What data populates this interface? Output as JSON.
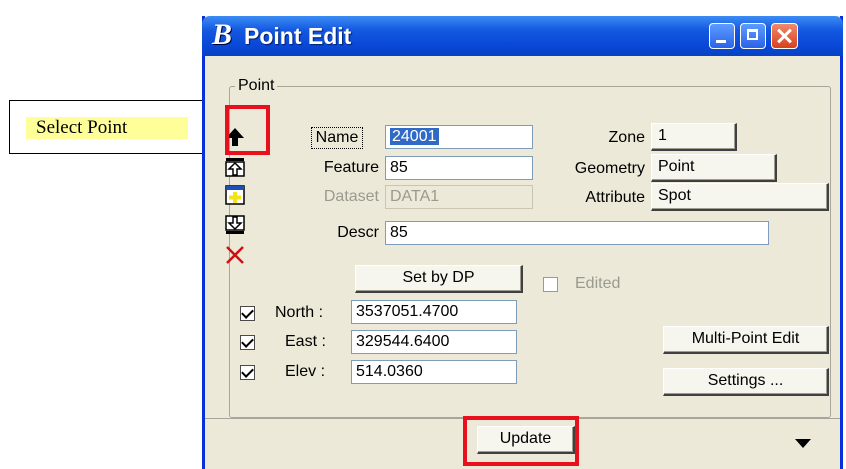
{
  "callout": {
    "text": "Select Point"
  },
  "window": {
    "title": "Point Edit",
    "logo": "B"
  },
  "group": {
    "title": "Point"
  },
  "tools": [
    {
      "icon": "up-arrow-icon"
    },
    {
      "icon": "first-point-icon"
    },
    {
      "icon": "add-point-icon"
    },
    {
      "icon": "last-point-icon"
    },
    {
      "icon": "delete-x-icon"
    }
  ],
  "fields": {
    "name": {
      "label": "Name",
      "value": "24001"
    },
    "feature": {
      "label": "Feature",
      "value": "85"
    },
    "dataset": {
      "label": "Dataset",
      "value": "DATA1"
    },
    "descr": {
      "label": "Descr",
      "value": "85"
    }
  },
  "zone": {
    "label": "Zone",
    "value": "1"
  },
  "geometry": {
    "label": "Geometry",
    "value": "Point"
  },
  "attribute": {
    "label": "Attribute",
    "value": "Spot"
  },
  "set_by_dp": "Set by DP",
  "edited": {
    "label": "Edited",
    "checked": false
  },
  "coords": {
    "north": {
      "label": "North :",
      "value": "3537051.4700",
      "checked": true
    },
    "east": {
      "label": "East :",
      "value": "329544.6400",
      "checked": true
    },
    "elev": {
      "label": "Elev :",
      "value": "514.0360",
      "checked": true
    }
  },
  "buttons": {
    "multi_point_edit": "Multi-Point Edit",
    "settings": "Settings ...",
    "update": "Update"
  },
  "colors": {
    "highlight_red": "#e8101c",
    "titlebar_blue": "#0a49d8",
    "callout_yellow": "#ffff99"
  }
}
